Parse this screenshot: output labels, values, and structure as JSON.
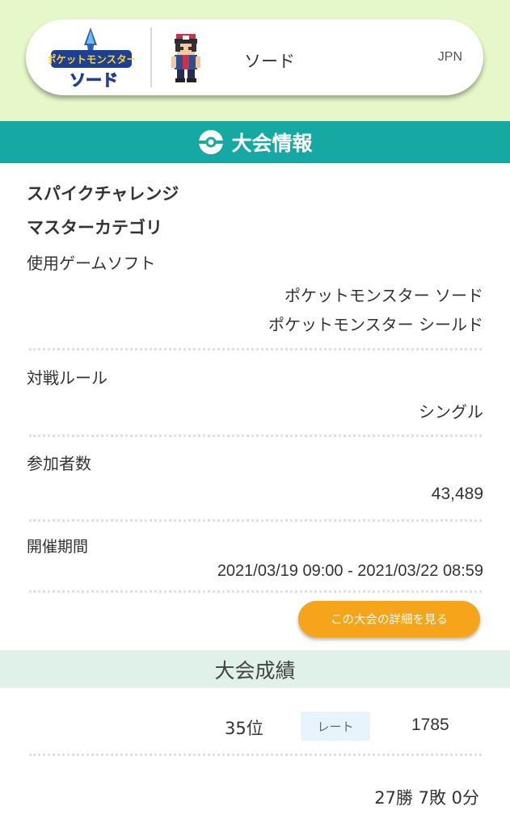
{
  "player_card": {
    "logo_text_top": "ポケットモンスター",
    "logo_text_bottom": "ソード",
    "version": "ソード",
    "region": "JPN"
  },
  "section_title": "大会情報",
  "tournament": {
    "name": "スパイクチャレンジ",
    "category": "マスターカテゴリ",
    "software_label": "使用ゲームソフト",
    "software_values": [
      "ポケットモンスター ソード",
      "ポケットモンスター シールド"
    ],
    "rule_label": "対戦ルール",
    "rule_value": "シングル",
    "participants_label": "参加者数",
    "participants_value": "43,489",
    "period_label": "開催期間",
    "period_value": "2021/03/19 09:00 - 2021/03/22 08:59",
    "detail_button": "この大会の詳細を見る"
  },
  "results": {
    "title": "大会成績",
    "rank": "35位",
    "rate_label": "レート",
    "rate_value": "1785",
    "record": "27勝 7敗 0分"
  },
  "colors": {
    "header_bg": "#e6f8c9",
    "section_header": "#16a8a3",
    "button": "#f6a51b",
    "results_header": "#dff1e8"
  }
}
